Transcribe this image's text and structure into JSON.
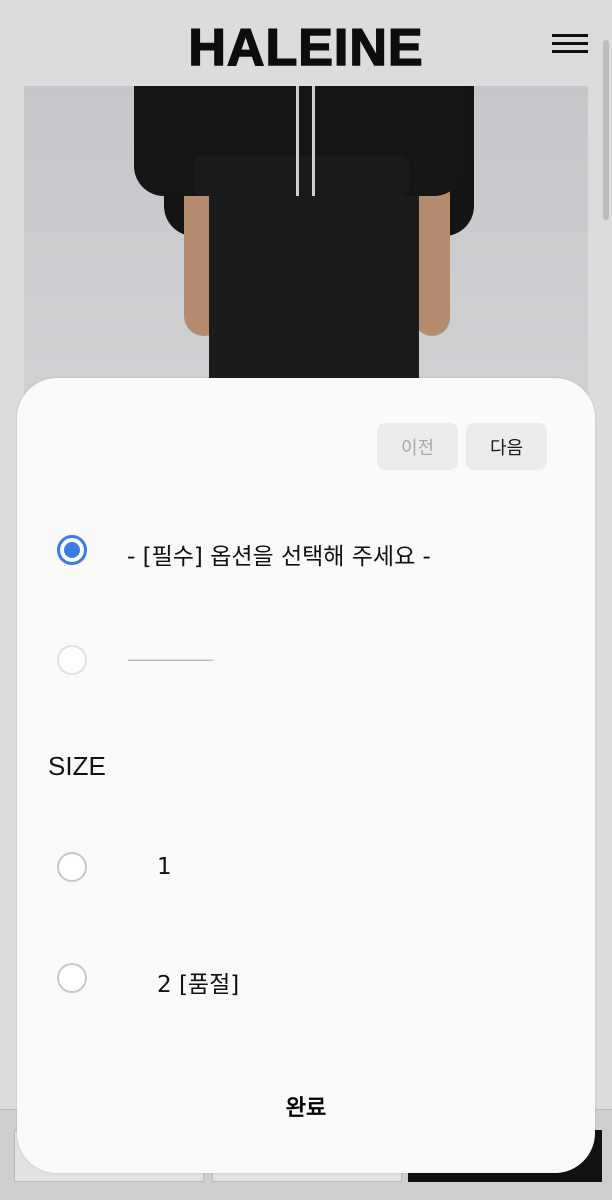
{
  "header": {
    "logo": "HALEINE",
    "menu_icon": "hamburger-menu-icon"
  },
  "modal": {
    "prev_label": "이전",
    "next_label": "다음",
    "options": [
      {
        "label": "- [필수] 옵션을 선택해 주세요 -",
        "selected": true
      },
      {
        "label": "-------------------",
        "selected": false
      }
    ],
    "size_heading": "SIZE",
    "sizes": [
      {
        "label": "1",
        "selected": false
      },
      {
        "label": "2 [품절]",
        "selected": false
      }
    ],
    "done_label": "완료"
  },
  "colors": {
    "accent": "#3c7be0",
    "modal_bg": "#fafafa",
    "overlay_bg": "#dcdcdc"
  }
}
